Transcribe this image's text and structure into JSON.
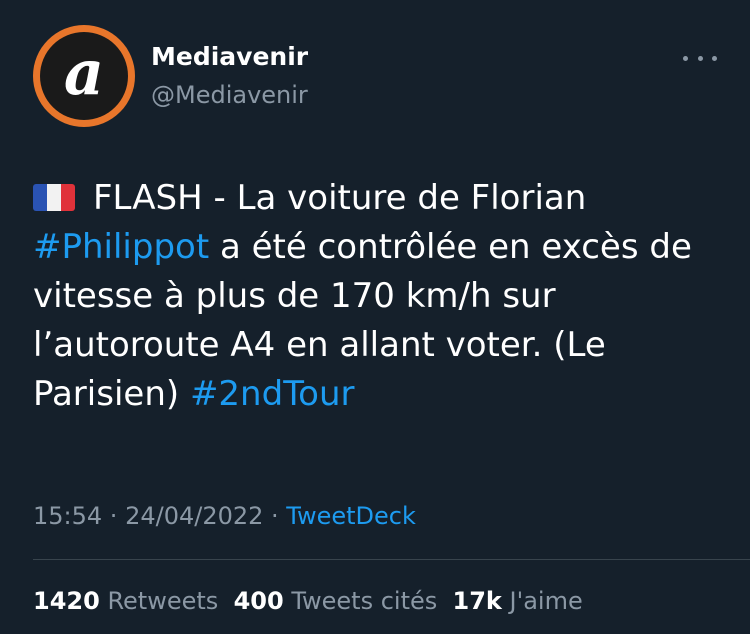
{
  "author": {
    "display_name": "Mediavenir",
    "handle": "@Mediavenir",
    "avatar_letter": "a"
  },
  "tweet": {
    "flag_icon": "france-flag-icon",
    "line1": "FLASH - La voiture de Florian",
    "hashtag1": "#Philippot",
    "text_after_hashtag1": " a été contrôlée en excès de vitesse à plus de 170 km/h sur l’autoroute A4 en allant voter. (Le Parisien) ",
    "hashtag2": "#2ndTour"
  },
  "meta": {
    "time": "15:54",
    "separator": " · ",
    "date": "24/04/2022",
    "source": "TweetDeck"
  },
  "stats": {
    "retweets_count": "1420",
    "retweets_label": "Retweets",
    "quotes_count": "400",
    "quotes_label": "Tweets cités",
    "likes_count": "17k",
    "likes_label": "J'aime"
  },
  "colors": {
    "background": "#15202b",
    "link": "#1d9bf0",
    "secondary_text": "#8b98a5",
    "avatar_ring": "#e8762b"
  }
}
